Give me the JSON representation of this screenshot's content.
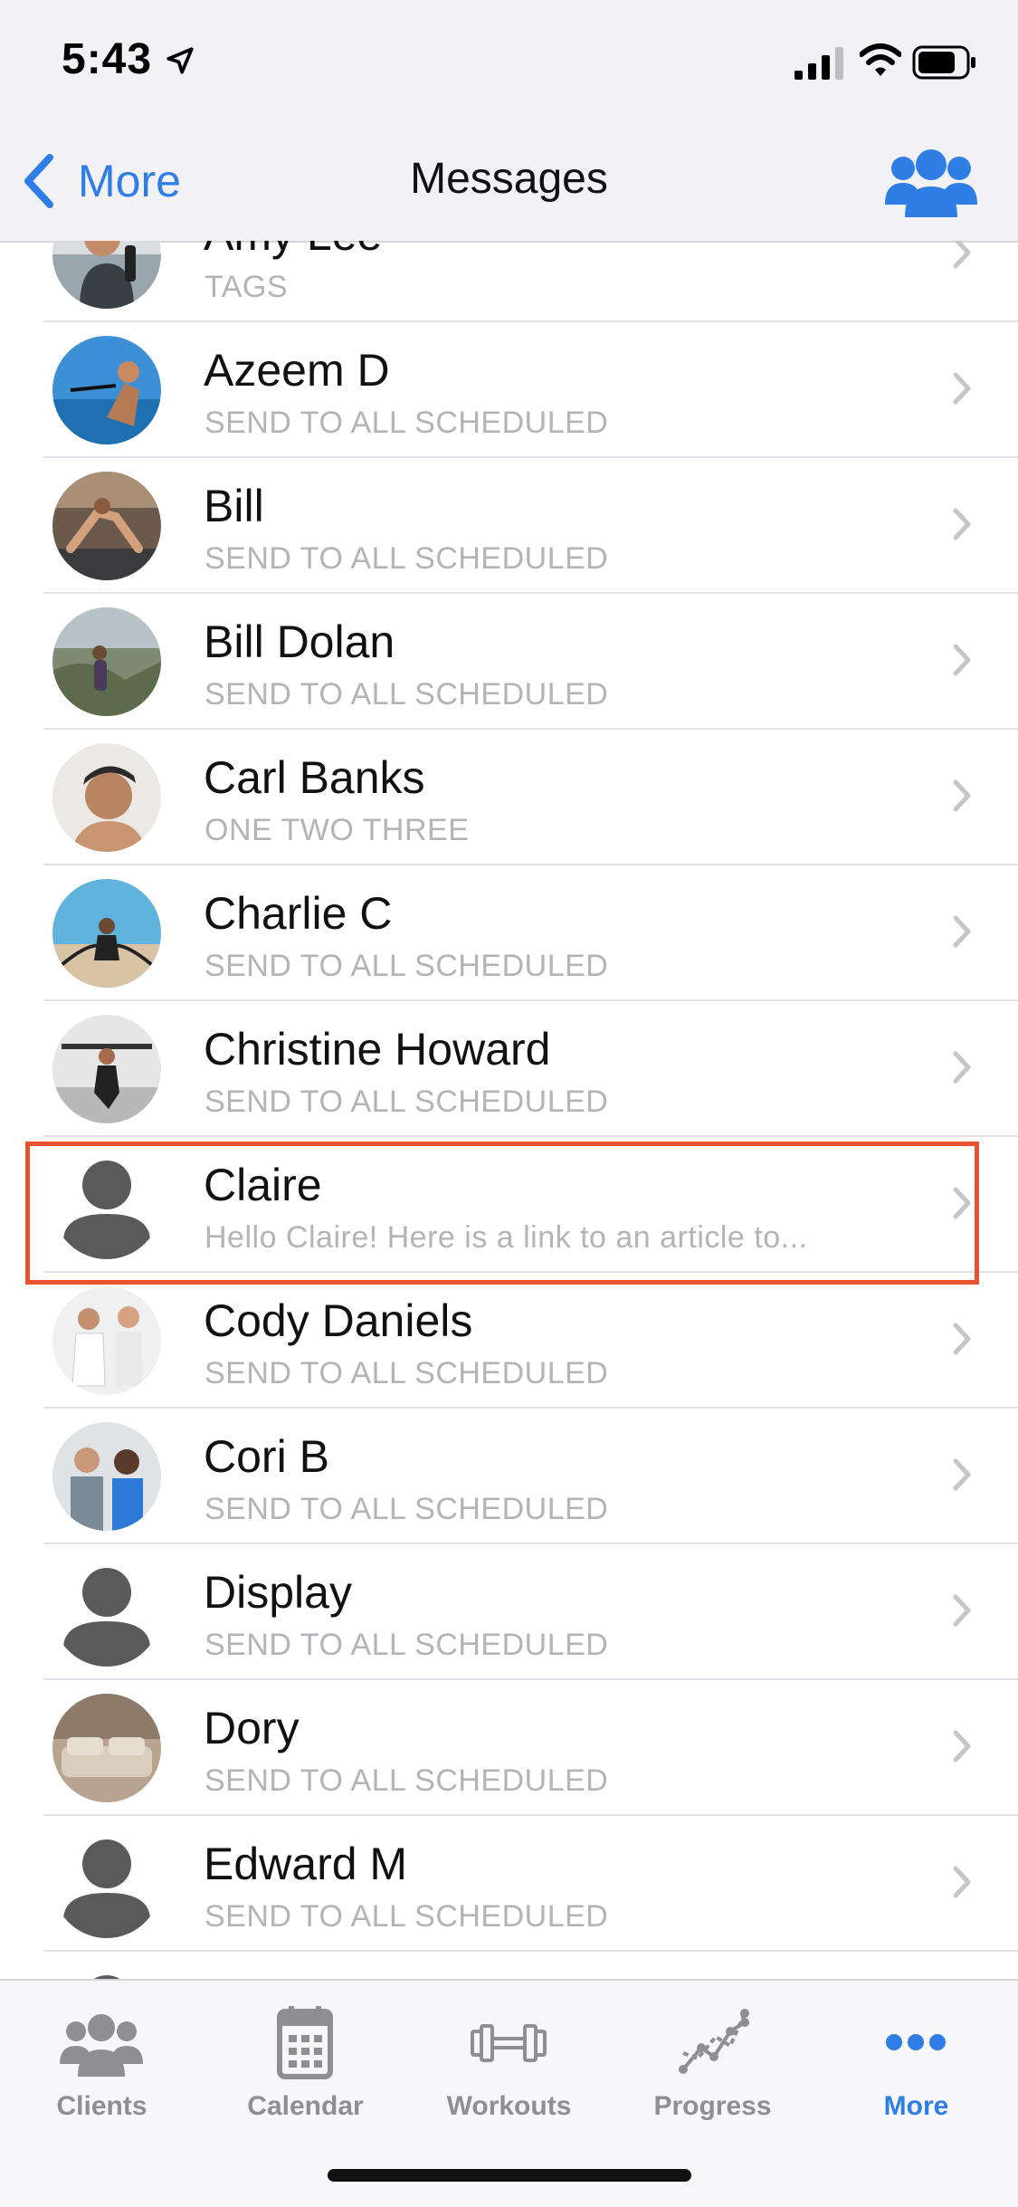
{
  "status_bar": {
    "time": "5:43"
  },
  "nav": {
    "back_label": "More",
    "title": "Messages"
  },
  "colors": {
    "accent": "#2f7ee6",
    "highlight": "#e8522e",
    "secondary_text": "#b3b3b8"
  },
  "threads": [
    {
      "name": "Amy Lee",
      "preview": "TAGS",
      "avatar": "photo"
    },
    {
      "name": "Azeem D",
      "preview": "SEND TO ALL SCHEDULED",
      "avatar": "photo"
    },
    {
      "name": "Bill",
      "preview": "SEND TO ALL SCHEDULED",
      "avatar": "photo"
    },
    {
      "name": "Bill Dolan",
      "preview": "SEND TO ALL SCHEDULED",
      "avatar": "photo"
    },
    {
      "name": "Carl Banks",
      "preview": "ONE TWO THREE",
      "avatar": "photo"
    },
    {
      "name": "Charlie C",
      "preview": "SEND TO ALL SCHEDULED",
      "avatar": "photo"
    },
    {
      "name": "Christine Howard",
      "preview": "SEND TO ALL SCHEDULED",
      "avatar": "photo"
    },
    {
      "name": "Claire",
      "preview": "Hello Claire! Here is a link to an article to...",
      "avatar": "placeholder",
      "highlighted": true
    },
    {
      "name": "Cody Daniels",
      "preview": "SEND TO ALL SCHEDULED",
      "avatar": "photo"
    },
    {
      "name": "Cori  B",
      "preview": "SEND TO ALL SCHEDULED",
      "avatar": "photo"
    },
    {
      "name": "Display",
      "preview": "SEND TO ALL SCHEDULED",
      "avatar": "placeholder"
    },
    {
      "name": "Dory",
      "preview": "SEND TO ALL SCHEDULED",
      "avatar": "photo"
    },
    {
      "name": "Edward M",
      "preview": "SEND TO ALL SCHEDULED",
      "avatar": "placeholder"
    }
  ],
  "tabs": [
    {
      "label": "Clients",
      "icon": "clients-icon",
      "active": false
    },
    {
      "label": "Calendar",
      "icon": "calendar-icon",
      "active": false
    },
    {
      "label": "Workouts",
      "icon": "dumbbell-icon",
      "active": false
    },
    {
      "label": "Progress",
      "icon": "progress-chart-icon",
      "active": false
    },
    {
      "label": "More",
      "icon": "more-dots-icon",
      "active": true
    }
  ]
}
